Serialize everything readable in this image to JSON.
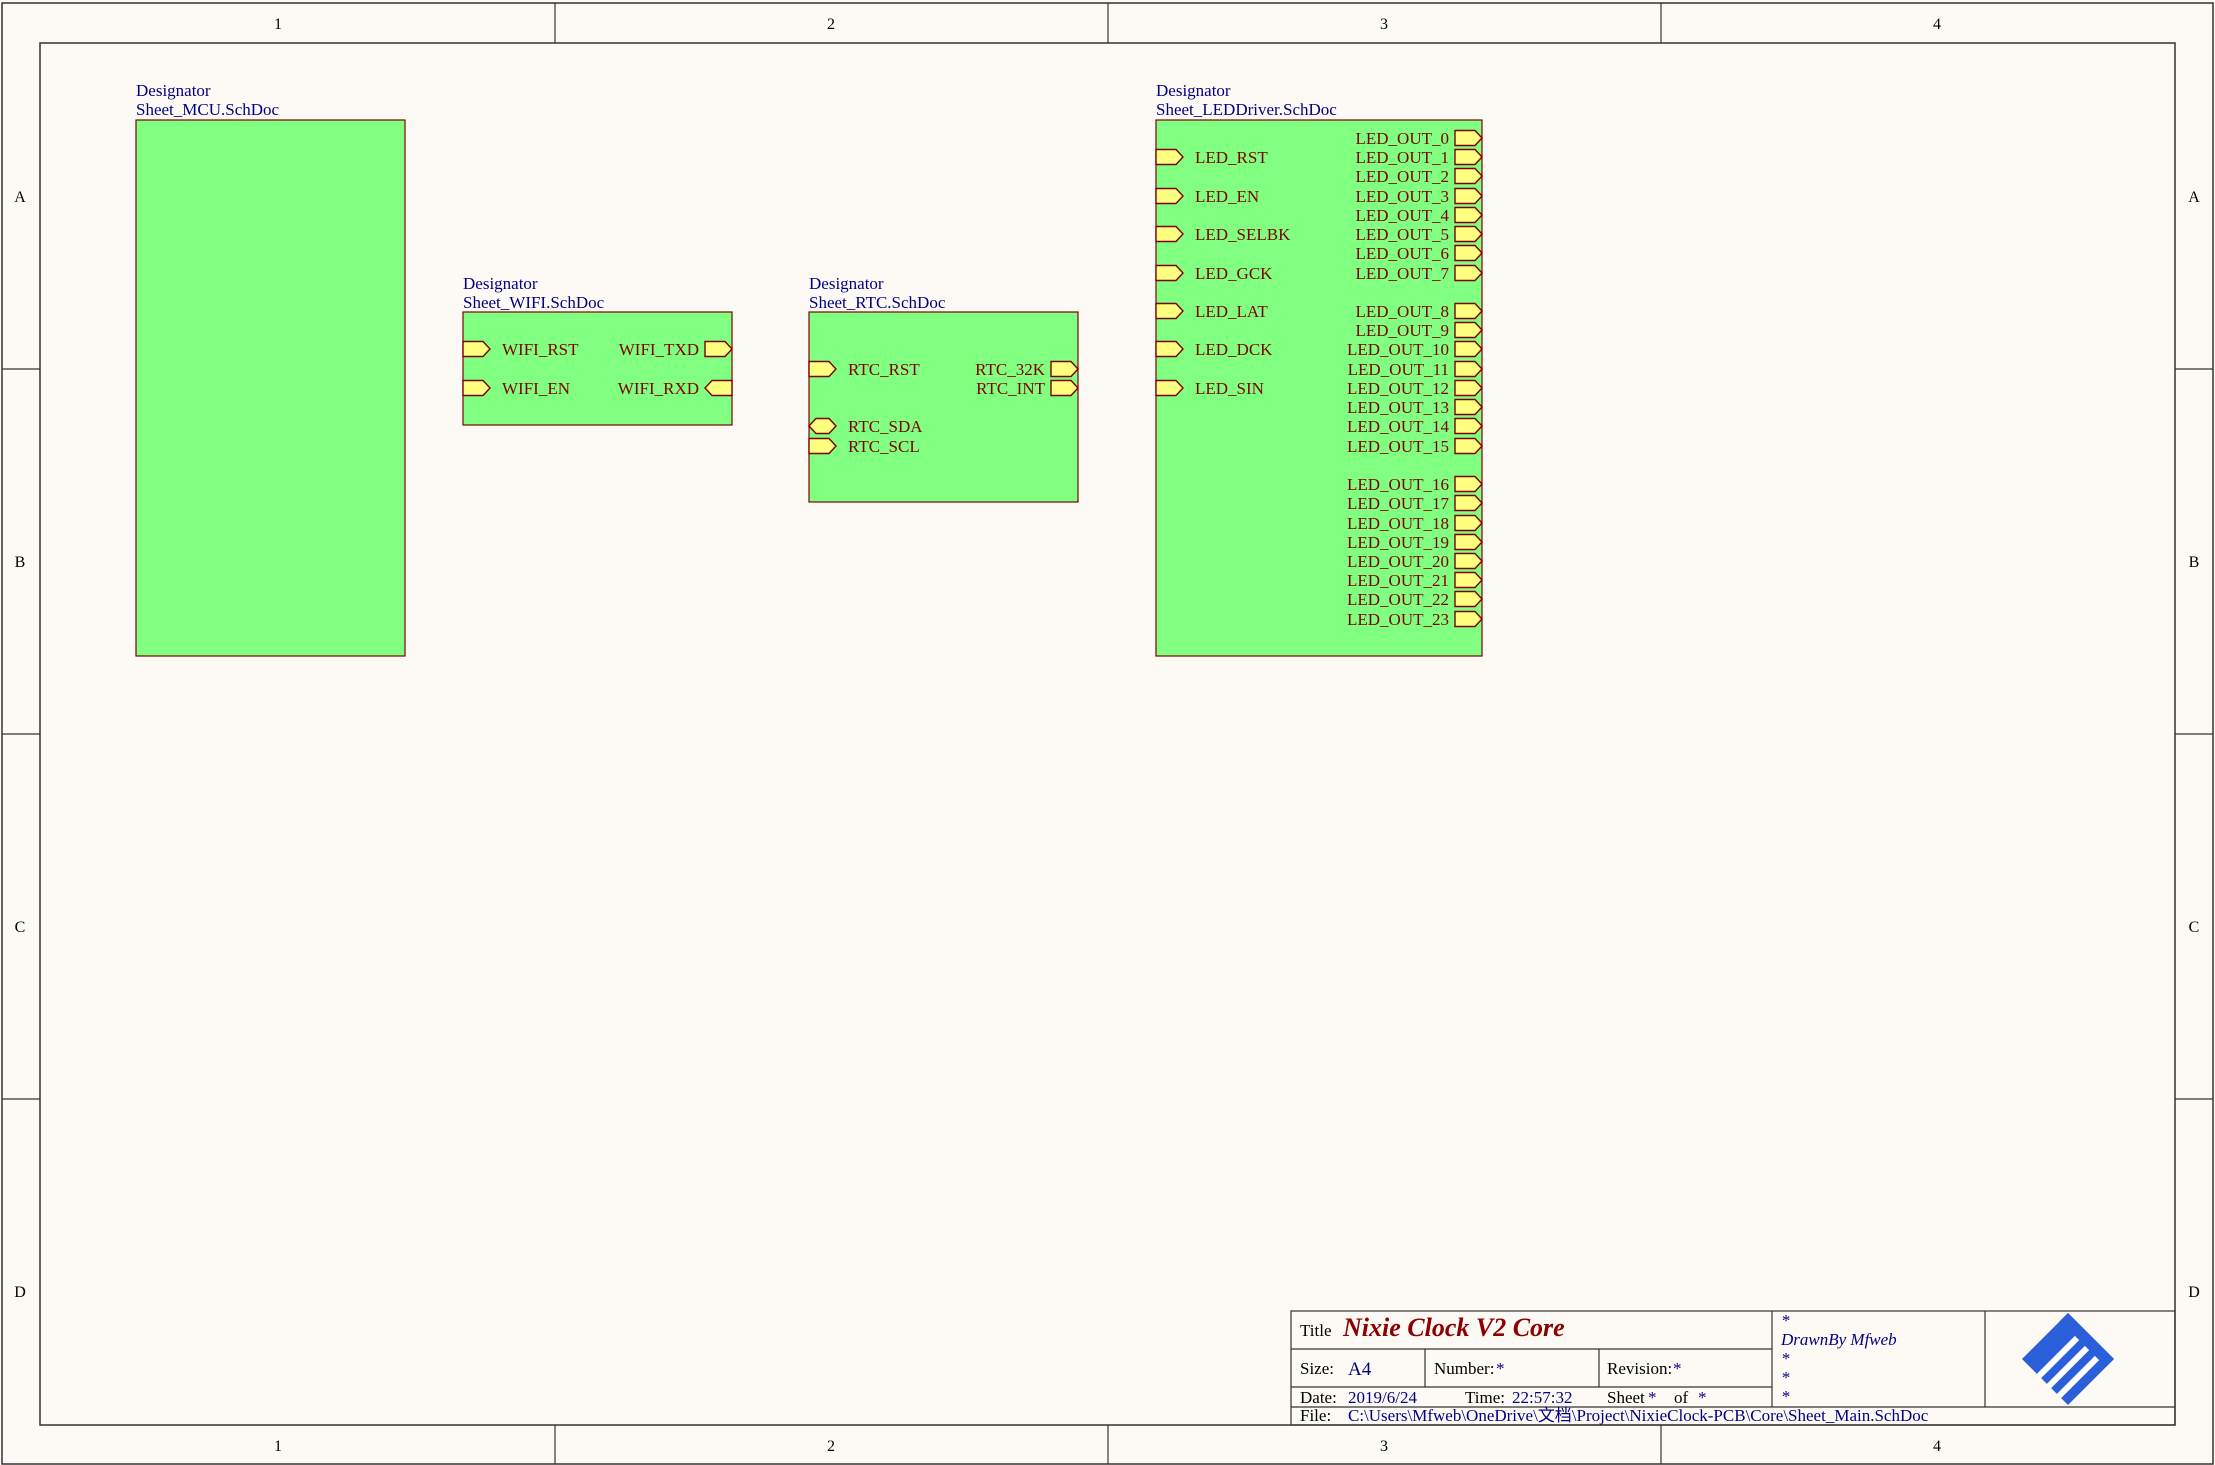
{
  "zones": {
    "columns": [
      "1",
      "2",
      "3",
      "4"
    ],
    "rows": [
      "A",
      "B",
      "C",
      "D"
    ]
  },
  "blocks": [
    {
      "id": "mcu",
      "designator": "Designator",
      "filename": "Sheet_MCU.SchDoc",
      "left_pins": [],
      "right_pins": []
    },
    {
      "id": "wifi",
      "designator": "Designator",
      "filename": "Sheet_WIFI.SchDoc",
      "left_pins": [
        {
          "label": "WIFI_RST",
          "dir": "in"
        },
        {
          "label": "WIFI_EN",
          "dir": "in"
        }
      ],
      "right_pins": [
        {
          "label": "WIFI_TXD",
          "dir": "out"
        },
        {
          "label": "WIFI_RXD",
          "dir": "in"
        }
      ]
    },
    {
      "id": "rtc",
      "designator": "Designator",
      "filename": "Sheet_RTC.SchDoc",
      "left_pins": [
        {
          "label": "RTC_RST",
          "dir": "in"
        },
        {
          "label": "RTC_SDA",
          "dir": "bidir"
        },
        {
          "label": "RTC_SCL",
          "dir": "in"
        }
      ],
      "right_pins": [
        {
          "label": "RTC_32K",
          "dir": "out"
        },
        {
          "label": "RTC_INT",
          "dir": "out"
        }
      ]
    },
    {
      "id": "led",
      "designator": "Designator",
      "filename": "Sheet_LEDDriver.SchDoc",
      "left_pins": [
        {
          "label": "LED_RST",
          "dir": "in"
        },
        {
          "label": "LED_EN",
          "dir": "in"
        },
        {
          "label": "LED_SELBK",
          "dir": "in"
        },
        {
          "label": "LED_GCK",
          "dir": "in"
        },
        {
          "label": "LED_LAT",
          "dir": "in"
        },
        {
          "label": "LED_DCK",
          "dir": "in"
        },
        {
          "label": "LED_SIN",
          "dir": "in"
        }
      ],
      "right_pins": [
        {
          "label": "LED_OUT_0",
          "dir": "out"
        },
        {
          "label": "LED_OUT_1",
          "dir": "out"
        },
        {
          "label": "LED_OUT_2",
          "dir": "out"
        },
        {
          "label": "LED_OUT_3",
          "dir": "out"
        },
        {
          "label": "LED_OUT_4",
          "dir": "out"
        },
        {
          "label": "LED_OUT_5",
          "dir": "out"
        },
        {
          "label": "LED_OUT_6",
          "dir": "out"
        },
        {
          "label": "LED_OUT_7",
          "dir": "out"
        },
        {
          "label": "LED_OUT_8",
          "dir": "out"
        },
        {
          "label": "LED_OUT_9",
          "dir": "out"
        },
        {
          "label": "LED_OUT_10",
          "dir": "out"
        },
        {
          "label": "LED_OUT_11",
          "dir": "out"
        },
        {
          "label": "LED_OUT_12",
          "dir": "out"
        },
        {
          "label": "LED_OUT_13",
          "dir": "out"
        },
        {
          "label": "LED_OUT_14",
          "dir": "out"
        },
        {
          "label": "LED_OUT_15",
          "dir": "out"
        },
        {
          "label": "LED_OUT_16",
          "dir": "out"
        },
        {
          "label": "LED_OUT_17",
          "dir": "out"
        },
        {
          "label": "LED_OUT_18",
          "dir": "out"
        },
        {
          "label": "LED_OUT_19",
          "dir": "out"
        },
        {
          "label": "LED_OUT_20",
          "dir": "out"
        },
        {
          "label": "LED_OUT_21",
          "dir": "out"
        },
        {
          "label": "LED_OUT_22",
          "dir": "out"
        },
        {
          "label": "LED_OUT_23",
          "dir": "out"
        }
      ]
    }
  ],
  "title_block": {
    "title_label": "Title",
    "title": "Nixie Clock V2 Core",
    "size_label": "Size:",
    "size": "A4",
    "number_label": "Number:",
    "number": "*",
    "revision_label": "Revision:",
    "revision": "*",
    "date_label": "Date:",
    "date": "2019/6/24",
    "time_label": "Time:",
    "time": "22:57:32",
    "sheet_label": "Sheet",
    "sheet": "*",
    "of_label": "of",
    "of": "*",
    "file_label": "File:",
    "file": "C:\\Users\\Mfweb\\OneDrive\\文档\\Project\\NixieClock-PCB\\Core\\Sheet_Main.SchDoc",
    "notes": [
      "*",
      "DrawnBy Mfweb",
      "*",
      "*",
      "*"
    ]
  },
  "colors": {
    "block_fill": "#80ff80",
    "port_fill": "#ffff80",
    "border": "#800000",
    "designator_text": "#000080",
    "logo": "#2b5fd9"
  }
}
